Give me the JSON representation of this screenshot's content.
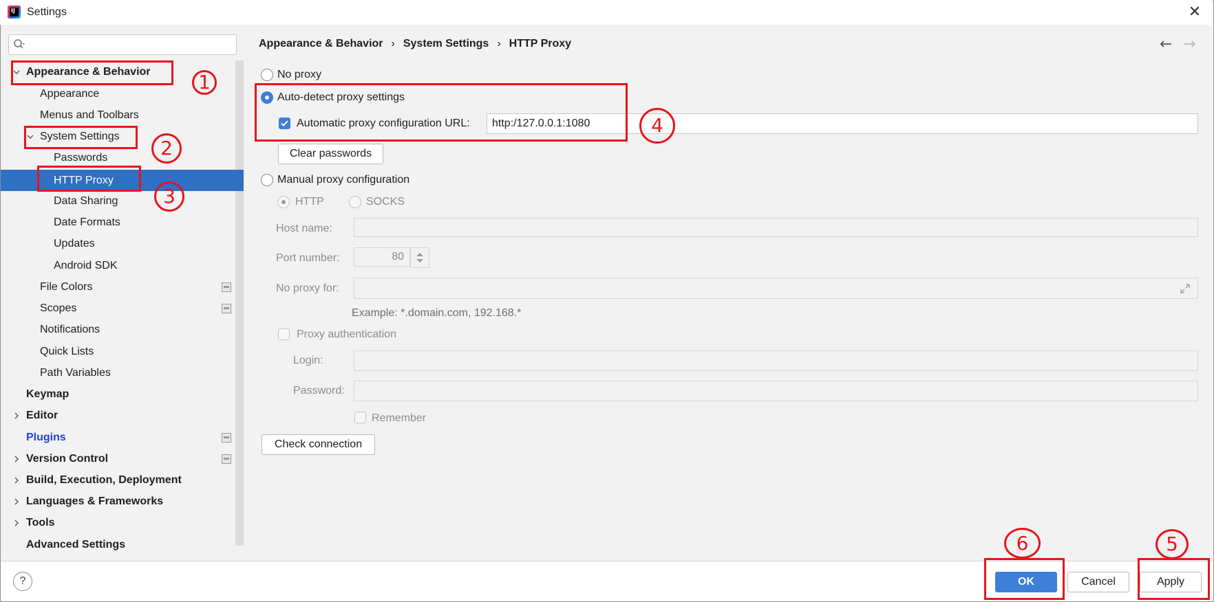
{
  "window": {
    "title": "Settings",
    "close_glyph": "✕",
    "app_icon": "intellij-icon",
    "app_icon_text": "IJ"
  },
  "search": {
    "placeholder": "",
    "icon": "search-icon"
  },
  "sidebar": {
    "appearance_behavior": "Appearance & Behavior",
    "appearance": "Appearance",
    "menus_toolbars": "Menus and Toolbars",
    "system_settings": "System Settings",
    "passwords": "Passwords",
    "http_proxy": "HTTP Proxy",
    "data_sharing": "Data Sharing",
    "date_formats": "Date Formats",
    "updates": "Updates",
    "android_sdk": "Android SDK",
    "file_colors": "File Colors",
    "scopes": "Scopes",
    "notifications": "Notifications",
    "quick_lists": "Quick Lists",
    "path_variables": "Path Variables",
    "keymap": "Keymap",
    "editor": "Editor",
    "plugins": "Plugins",
    "version_control": "Version Control",
    "build": "Build, Execution, Deployment",
    "languages": "Languages & Frameworks",
    "tools": "Tools",
    "advanced": "Advanced Settings"
  },
  "breadcrumb": {
    "part1": "Appearance & Behavior",
    "part2": "System Settings",
    "part3": "HTTP Proxy",
    "sep": "›"
  },
  "nav": {
    "back": "←",
    "forward": "→"
  },
  "proxy": {
    "no_proxy": "No proxy",
    "auto_detect": "Auto-detect proxy settings",
    "auto_config_label": "Automatic proxy configuration URL:",
    "auto_config_url": "http:/127.0.0.1:1080",
    "clear_passwords": "Clear passwords",
    "manual": "Manual proxy configuration",
    "http": "HTTP",
    "socks": "SOCKS",
    "host_name": "Host name:",
    "port_number": "Port number:",
    "port_value": "80",
    "no_proxy_for": "No proxy for:",
    "example": "Example: *.domain.com, 192.168.*",
    "proxy_auth": "Proxy authentication",
    "login": "Login:",
    "password": "Password:",
    "remember": "Remember",
    "check_connection": "Check connection"
  },
  "footer": {
    "help": "?",
    "ok": "OK",
    "cancel": "Cancel",
    "apply": "Apply"
  },
  "annotations": {
    "n1": "1",
    "n2": "2",
    "n3": "3",
    "n4": "4",
    "n5": "5",
    "n6": "6"
  },
  "colors": {
    "selection": "#2f6fc4",
    "accent": "#3e7ed6",
    "annotation": "#e8141a",
    "link": "#2340d8"
  }
}
